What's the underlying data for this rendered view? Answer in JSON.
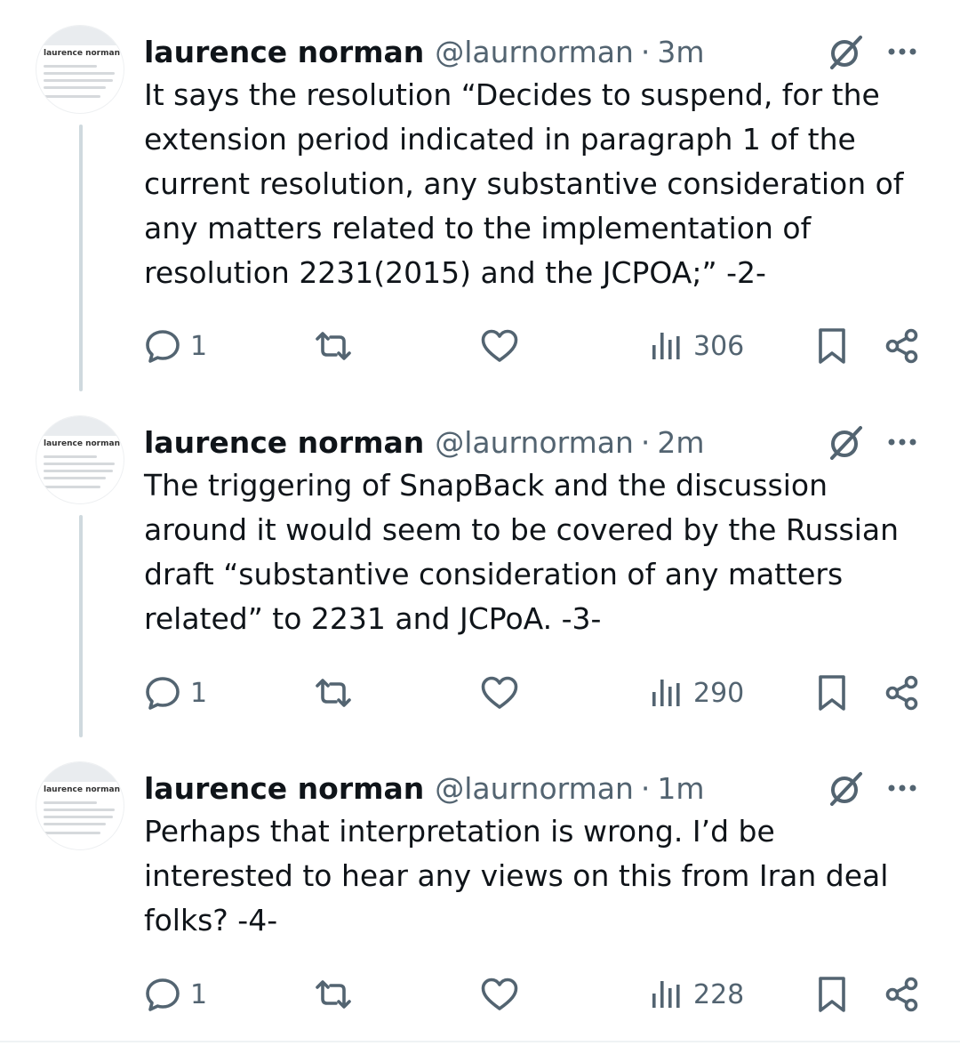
{
  "tweets": [
    {
      "name": "laurence norman",
      "handle": "@laurnorman",
      "separator": "·",
      "time": "3m",
      "text": "It says the resolution “Decides to suspend, for the extension period indicated in paragraph 1 of the current resolution, any substantive consideration of any matters related to the implementation of resolution 2231(2015) and the JCPOA;” -2-",
      "replies": "1",
      "views": "306"
    },
    {
      "name": "laurence norman",
      "handle": "@laurnorman",
      "separator": "·",
      "time": "2m",
      "text": "The triggering of SnapBack and the discussion around it would seem to be covered by the Russian draft “substantive consideration of any matters related” to 2231 and JCPoA. -3-",
      "replies": "1",
      "views": "290"
    },
    {
      "name": "laurence norman",
      "handle": "@laurnorman",
      "separator": "·",
      "time": "1m",
      "text": "Perhaps that interpretation is wrong. I’d be interested to hear any views on this from Iran deal folks? -4-",
      "replies": "1",
      "views": "228"
    }
  ],
  "avatar_preview_name": "laurence norman",
  "colors": {
    "text": "#0f1419",
    "secondary": "#536471",
    "thread": "#cfd9de",
    "verified": "#1d9bf0"
  },
  "icons": [
    "grok-icon",
    "more-icon",
    "reply-icon",
    "retweet-icon",
    "like-icon",
    "views-icon",
    "bookmark-icon",
    "share-icon"
  ]
}
